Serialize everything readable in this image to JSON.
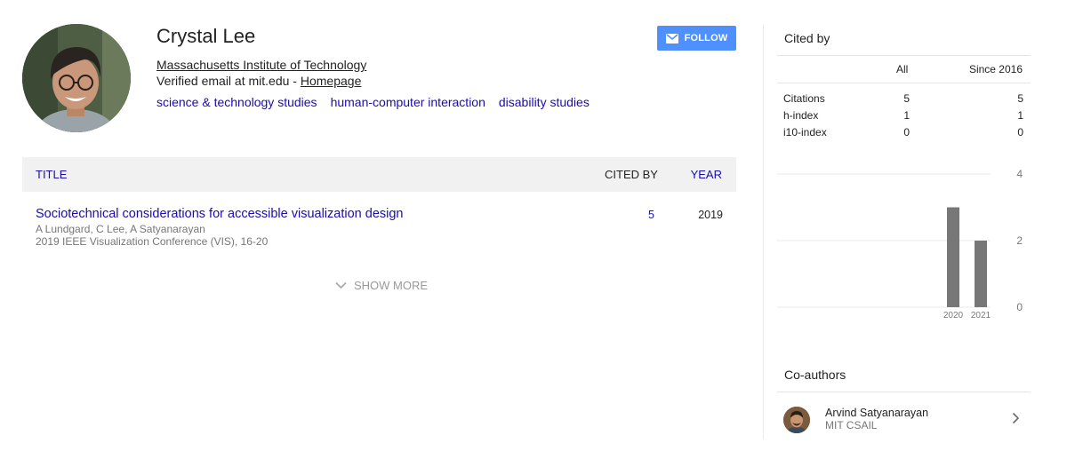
{
  "profile": {
    "name": "Crystal Lee",
    "affiliation": "Massachusetts Institute of Technology",
    "email_text": "Verified email at mit.edu - ",
    "homepage_label": "Homepage",
    "interests": [
      "science & technology studies",
      "human-computer interaction",
      "disability studies"
    ],
    "follow_label": "FOLLOW",
    "avatar_icon": "profile-photo"
  },
  "articles": {
    "headers": {
      "title": "TITLE",
      "cited_by": "CITED BY",
      "year": "YEAR"
    },
    "rows": [
      {
        "title": "Sociotechnical considerations for accessible visualization design",
        "authors": "A Lundgard, C Lee, A Satyanarayan",
        "venue": "2019 IEEE Visualization Conference (VIS), 16-20",
        "cited_by": "5",
        "year": "2019"
      }
    ],
    "show_more_label": "SHOW MORE"
  },
  "cited_by": {
    "title": "Cited by",
    "columns": {
      "all": "All",
      "since": "Since 2016"
    },
    "rows": [
      {
        "label": "Citations",
        "all": "5",
        "since": "5"
      },
      {
        "label": "h-index",
        "all": "1",
        "since": "1"
      },
      {
        "label": "i10-index",
        "all": "0",
        "since": "0"
      }
    ]
  },
  "chart_data": {
    "type": "bar",
    "categories": [
      "2020",
      "2021"
    ],
    "values": [
      3,
      2
    ],
    "ylim": [
      0,
      4
    ],
    "yticks": [
      "0",
      "2",
      "4"
    ],
    "grid": true,
    "bar_color": "#777777"
  },
  "coauthors": {
    "title": "Co-authors",
    "items": [
      {
        "name": "Arvind Satyanarayan",
        "affiliation": "MIT CSAIL"
      }
    ]
  },
  "colors": {
    "link": "#1a0dab",
    "follow_button": "#4d90fe",
    "table_header_bg": "#f1f1f1"
  }
}
